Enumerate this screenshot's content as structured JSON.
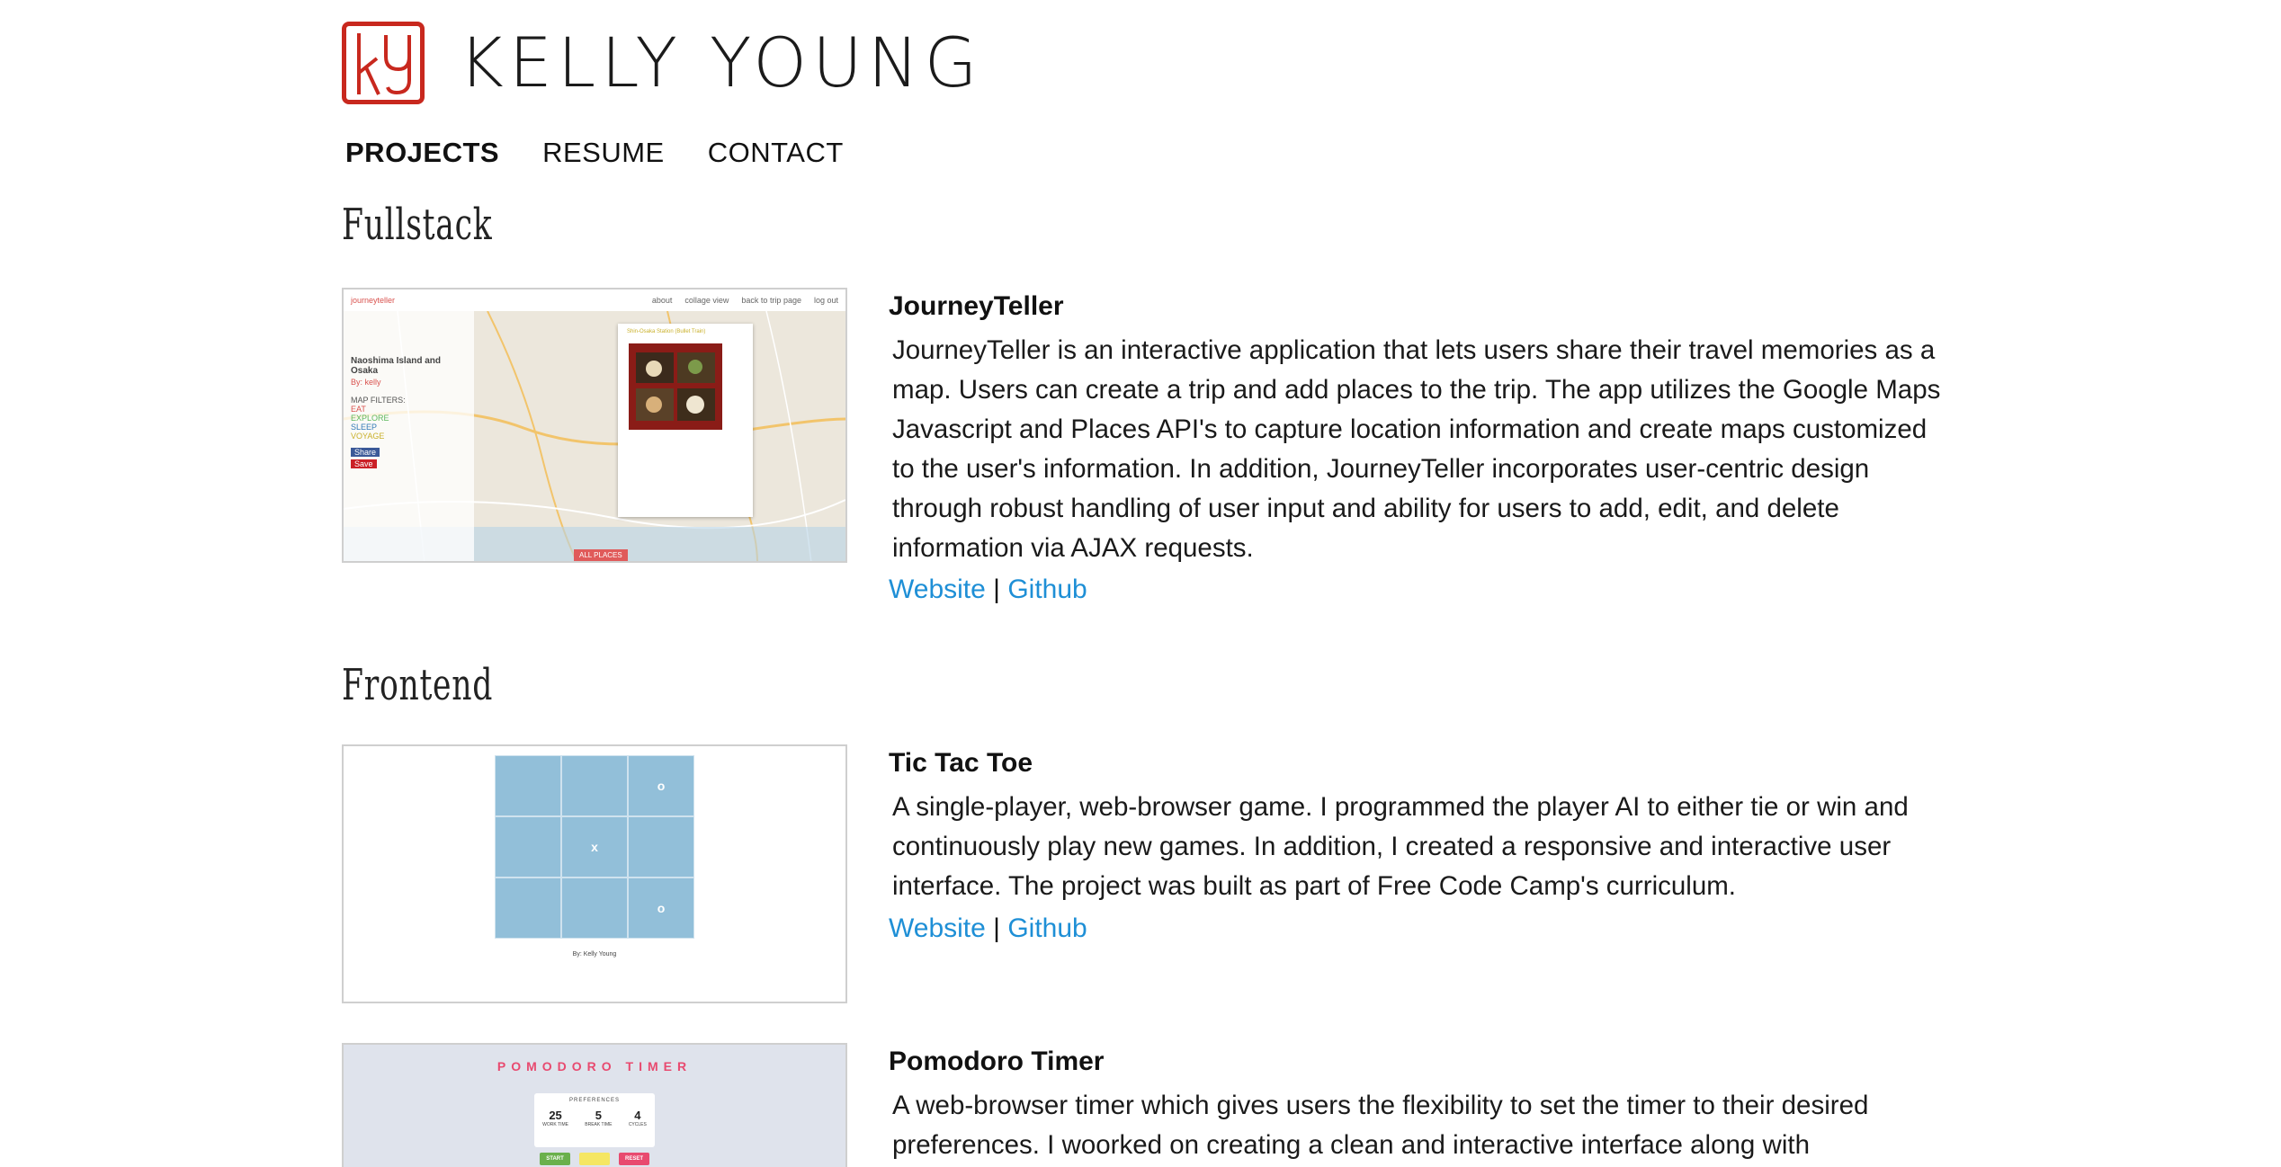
{
  "header": {
    "logo_text": "ky",
    "site_title": "KELLY YOUNG"
  },
  "nav": {
    "items": [
      {
        "label": "PROJECTS",
        "active": true
      },
      {
        "label": "RESUME",
        "active": false
      },
      {
        "label": "CONTACT",
        "active": false
      }
    ]
  },
  "sections": [
    {
      "heading": "Fullstack",
      "projects": [
        {
          "title": "JourneyTeller",
          "description": "JourneyTeller is an interactive application that lets users share their travel memories as a map. Users can create a trip and add places to the trip. The app utilizes the Google Maps Javascript and Places API's to capture location information and create maps customized to the user's information. In addition, JourneyTeller incorporates user-centric design through robust handling of user input and ability for users to add, edit, and delete information via AJAX requests.",
          "link_website": "Website",
          "link_separator": "|",
          "link_github": "Github",
          "thumb": {
            "brand": "journeyteller",
            "nav": [
              "about",
              "collage view",
              "back to trip page",
              "log out"
            ],
            "trip_title": "Naoshima Island and Osaka",
            "trip_by": "By: kelly",
            "filters_label": "MAP FILTERS:",
            "filters": [
              "EAT",
              "EXPLORE",
              "SLEEP",
              "VOYAGE"
            ],
            "share": "Share",
            "save": "Save",
            "popup_title": "Shin-Osaka Station (Bullet Train)",
            "all_places": "ALL PLACES"
          }
        }
      ]
    },
    {
      "heading": "Frontend",
      "projects": [
        {
          "title": "Tic Tac Toe",
          "description": "A single-player, web-browser game. I programmed the player AI to either tie or win and continuously play new games. In addition, I created a responsive and interactive user interface. The project was built as part of Free Code Camp's curriculum.",
          "link_website": "Website",
          "link_separator": "|",
          "link_github": "Github",
          "thumb": {
            "cells": [
              "",
              "",
              "o",
              "",
              "x",
              "",
              "",
              "",
              "o"
            ],
            "credit": "By: Kelly Young"
          }
        },
        {
          "title": "Pomodoro Timer",
          "description": "A web-browser timer which gives users the flexibility to set the timer to their desired preferences. I woorked on creating a clean and interactive interface along with",
          "thumb": {
            "title": "POMODORO TIMER",
            "prefs_label": "PREFERENCES",
            "values": [
              {
                "value": "25",
                "label": "WORK TIME"
              },
              {
                "value": "5",
                "label": "BREAK TIME"
              },
              {
                "value": "4",
                "label": "CYCLES"
              }
            ],
            "buttons": [
              {
                "label": "START",
                "color": "#6ab04c"
              },
              {
                "label": "PAUSE",
                "color": "#f5e663"
              },
              {
                "label": "RESET",
                "color": "#e84a6f"
              }
            ]
          }
        }
      ]
    }
  ],
  "colors": {
    "link": "#1e8fd6",
    "logo_red": "#c8281e",
    "ttt_board": "#92bfd9"
  }
}
